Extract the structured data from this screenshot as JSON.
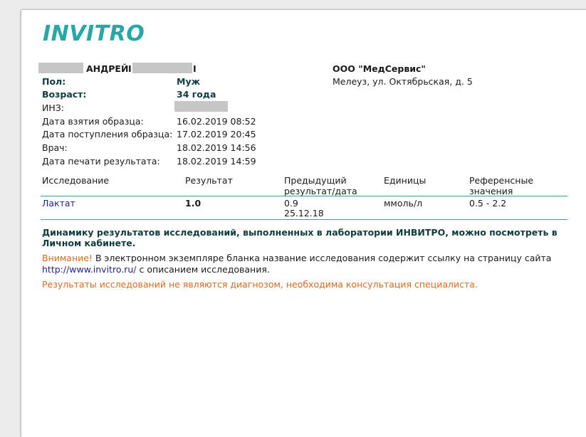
{
  "logo": "INVITRO",
  "patient": {
    "first_name": "АНДРЕЙ",
    "name_fragment": "I",
    "name_tail": "I"
  },
  "lab": {
    "name": "ООО \"МедСервис\"",
    "address": "Мелеуз, ул. Октябрьская, д. 5"
  },
  "fields": [
    {
      "label": "Пол:",
      "value": "Муж"
    },
    {
      "label": "Возраст:",
      "value": "34 года"
    },
    {
      "label": "ИНЗ:",
      "value": ""
    },
    {
      "label": "Дата взятия образца:",
      "value": "16.02.2019 08:52"
    },
    {
      "label": "Дата поступления образца:",
      "value": "17.02.2019 20:45"
    },
    {
      "label": "Врач:",
      "value": "18.02.2019 14:56"
    },
    {
      "label": "Дата печати результата:",
      "value": "18.02.2019 14:59"
    }
  ],
  "table": {
    "headers": {
      "test": "Исследование",
      "result": "Результат",
      "previous_line1": "Предыдущий",
      "previous_line2": "результат/дата",
      "units": "Единицы",
      "reference_line1": "Референсные",
      "reference_line2": "значения"
    },
    "rows": [
      {
        "test": "Лактат",
        "result": "1.0",
        "previous_value": "0.9",
        "previous_date": "25.12.18",
        "units": "ммоль/л",
        "reference": "0.5 - 2.2"
      }
    ]
  },
  "notes": {
    "dynamics_line1": "Динамику результатов исследований, выполненных в лаборатории ИНВИТРО, можно посмотреть в",
    "dynamics_line2": "Личном кабинете.",
    "attention_label": "Внимание!",
    "attention_text": " В электронном экземпляре бланка название исследования содержит ссылку на страницу сайта",
    "site_link": "http://www.invitro.ru/",
    "site_text": " с описанием исследования.",
    "disclaimer": "Результаты исследований не являются диагнозом, необходима консультация специалиста."
  }
}
